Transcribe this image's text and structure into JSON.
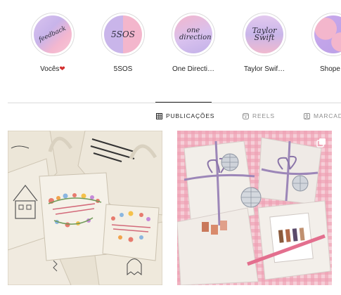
{
  "highlights": [
    {
      "label": "Vocês",
      "cover_text": "feedback",
      "badge": "heart"
    },
    {
      "label": "5SOS",
      "cover_text": "5SOS"
    },
    {
      "label": "One Directi…",
      "cover_text": "one direction"
    },
    {
      "label": "Taylor Swif…",
      "cover_text": "Taylor Swift"
    },
    {
      "label": "Shope",
      "cover_text": ""
    }
  ],
  "tabs": [
    {
      "label": "PUBLICAÇÕES",
      "icon": "grid-icon",
      "active": true
    },
    {
      "label": "REELS",
      "icon": "reels-icon",
      "active": false
    },
    {
      "label": "MARCAD",
      "icon": "tagged-icon",
      "active": false
    }
  ],
  "posts": [
    {
      "description": "canvas-tote-bags-with-embroidery"
    },
    {
      "description": "gift-packages-with-ribbons",
      "multiple": true
    }
  ],
  "colors": {
    "text": "#262626",
    "muted": "#8e8e8e",
    "divider": "#dbdbdb",
    "heart": "#d32f2f"
  }
}
